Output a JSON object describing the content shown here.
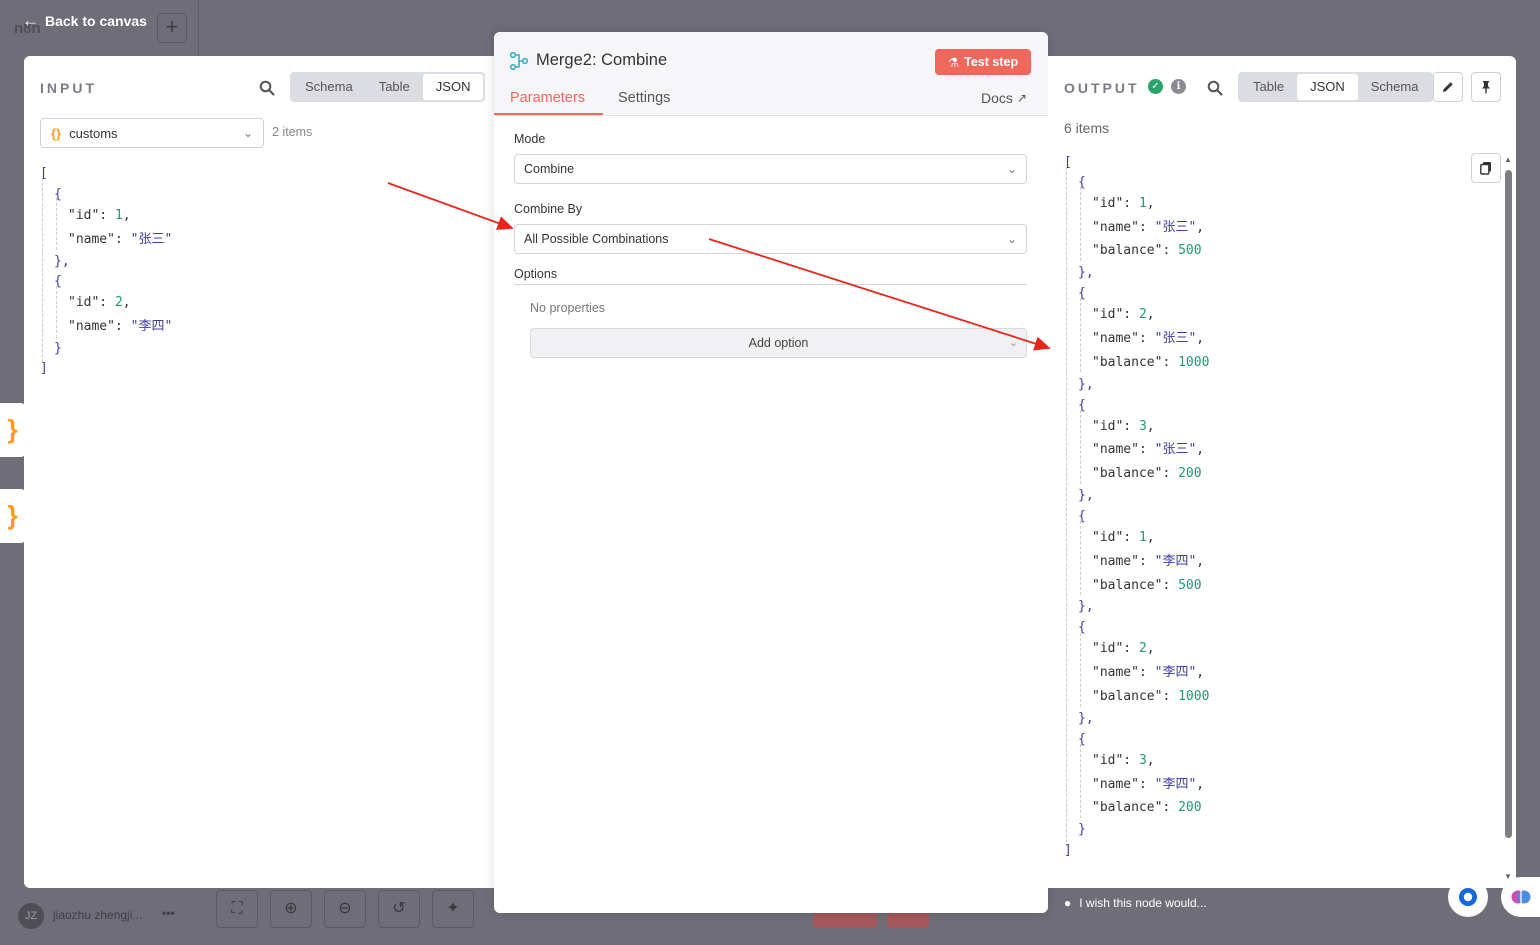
{
  "app": {
    "back_label": "Back to canvas",
    "ghost_logo": "n8n"
  },
  "input": {
    "title": "INPUT",
    "view_tabs": [
      "Schema",
      "Table",
      "JSON"
    ],
    "active_view": "JSON",
    "source_node": "customs",
    "item_count": "2 items",
    "items": [
      {
        "id": "1",
        "name": "\"张三\""
      },
      {
        "id": "2",
        "name": "\"李四\""
      }
    ]
  },
  "node": {
    "title": "Merge2: Combine",
    "test_label": "Test step",
    "tabs": [
      "Parameters",
      "Settings"
    ],
    "docs_label": "Docs",
    "mode_label": "Mode",
    "mode_value": "Combine",
    "combine_by_label": "Combine By",
    "combine_by_value": "All Possible Combinations",
    "options_label": "Options",
    "no_properties": "No properties",
    "add_option": "Add option"
  },
  "output": {
    "title": "OUTPUT",
    "view_tabs": [
      "Table",
      "JSON",
      "Schema"
    ],
    "active_view": "JSON",
    "item_count": "6 items",
    "items": [
      {
        "id": "1",
        "name": "\"张三\"",
        "balance": "500"
      },
      {
        "id": "2",
        "name": "\"张三\"",
        "balance": "1000"
      },
      {
        "id": "3",
        "name": "\"张三\"",
        "balance": "200"
      },
      {
        "id": "1",
        "name": "\"李四\"",
        "balance": "500"
      },
      {
        "id": "2",
        "name": "\"李四\"",
        "balance": "1000"
      },
      {
        "id": "3",
        "name": "\"李四\"",
        "balance": "200"
      }
    ]
  },
  "footer": {
    "user_initials": "JZ",
    "user_name": "jiaozhu zhengji...",
    "wish": "I wish this node would..."
  },
  "colors": {
    "accent": "#f0675c",
    "success": "#29a36a",
    "json_number": "#1f9a6c",
    "json_string": "#3d3f9e",
    "annotation_arrow": "#e8251b"
  }
}
